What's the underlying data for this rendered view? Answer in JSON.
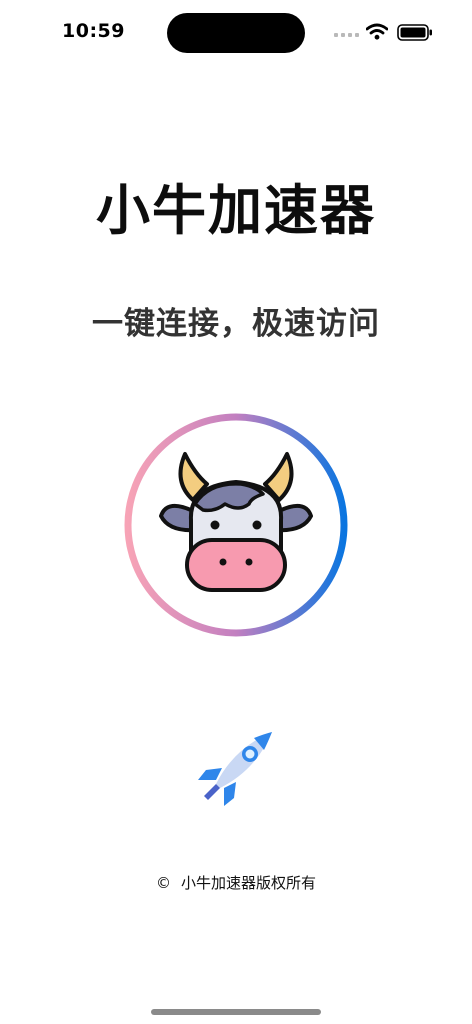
{
  "status_bar": {
    "time": "10:59",
    "icons": [
      "signal-icon",
      "wifi-icon",
      "battery-icon"
    ]
  },
  "app": {
    "title": "小牛加速器",
    "subtitle": "一键连接，极速访问"
  },
  "logo": {
    "icon": "cow-icon",
    "ring_gradient_start": "#f7a3b6",
    "ring_gradient_end": "#0a75e0",
    "nose_color": "#f79aaf",
    "horn_color": "#f3cd80",
    "patch_color": "#7c7fa6"
  },
  "action": {
    "icon": "rocket-icon"
  },
  "footer": {
    "copyright_symbol": "©",
    "text": "小牛加速器版权所有"
  }
}
